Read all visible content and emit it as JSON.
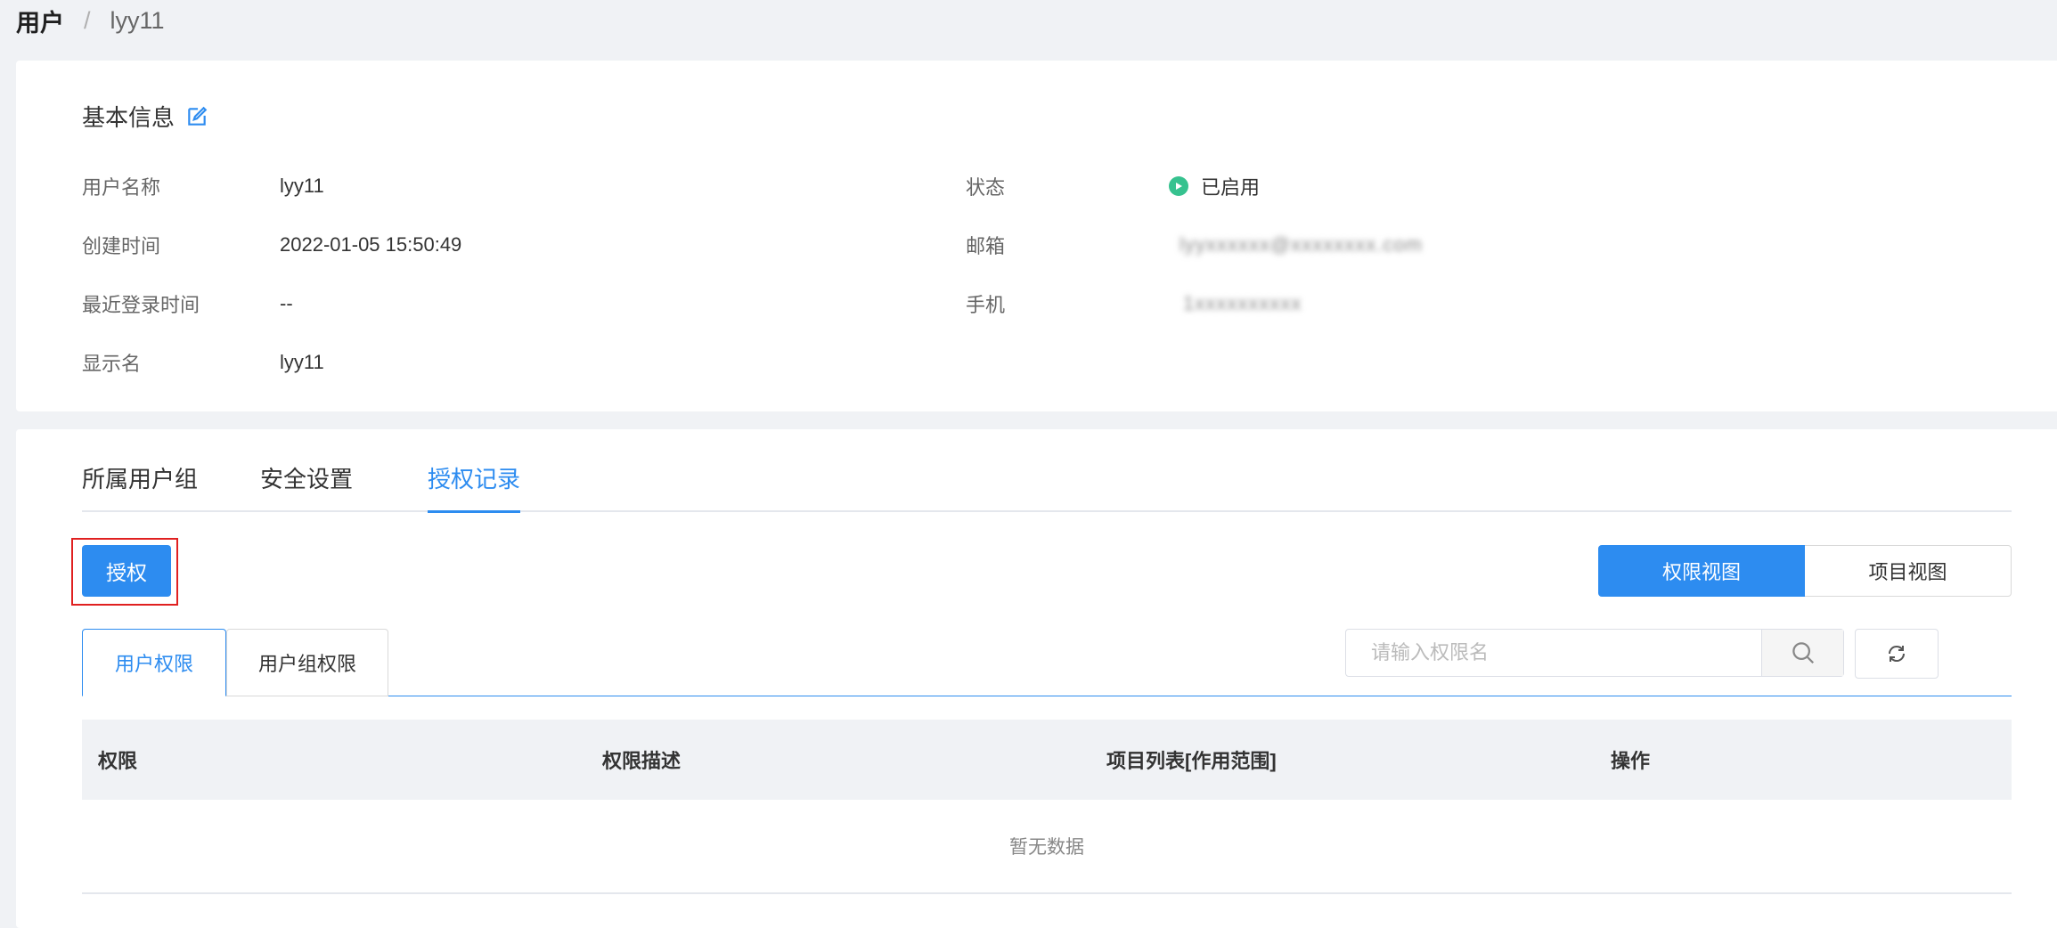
{
  "breadcrumb": {
    "root": "用户",
    "separator": "/",
    "current": "lyy11"
  },
  "basic_info": {
    "title": "基本信息",
    "fields": {
      "username": {
        "label": "用户名称",
        "value": "lyy11"
      },
      "created": {
        "label": "创建时间",
        "value": "2022-01-05 15:50:49"
      },
      "last_login": {
        "label": "最近登录时间",
        "value": "--"
      },
      "display_name": {
        "label": "显示名",
        "value": "lyy11"
      },
      "status": {
        "label": "状态",
        "value": "已启用"
      },
      "email": {
        "label": "邮箱",
        "value": "lyyxxxxxx@xxxxxxxx.com"
      },
      "phone": {
        "label": "手机",
        "value": "1xxxxxxxxxx"
      }
    },
    "status_color": "#36c28f"
  },
  "tabs": [
    {
      "label": "所属用户组"
    },
    {
      "label": "安全设置"
    },
    {
      "label": "授权记录"
    }
  ],
  "active_tab": "授权记录",
  "authorize_button": "授权",
  "view_toggle": {
    "permission_view": "权限视图",
    "project_view": "项目视图"
  },
  "subtabs": {
    "user_permissions": "用户权限",
    "group_permissions": "用户组权限"
  },
  "search": {
    "placeholder": "请输入权限名"
  },
  "table": {
    "columns": [
      "权限",
      "权限描述",
      "项目列表[作用范围]",
      "操作"
    ],
    "empty_text": "暂无数据"
  },
  "colors": {
    "primary": "#2d8cf0",
    "highlight": "#e02020"
  }
}
